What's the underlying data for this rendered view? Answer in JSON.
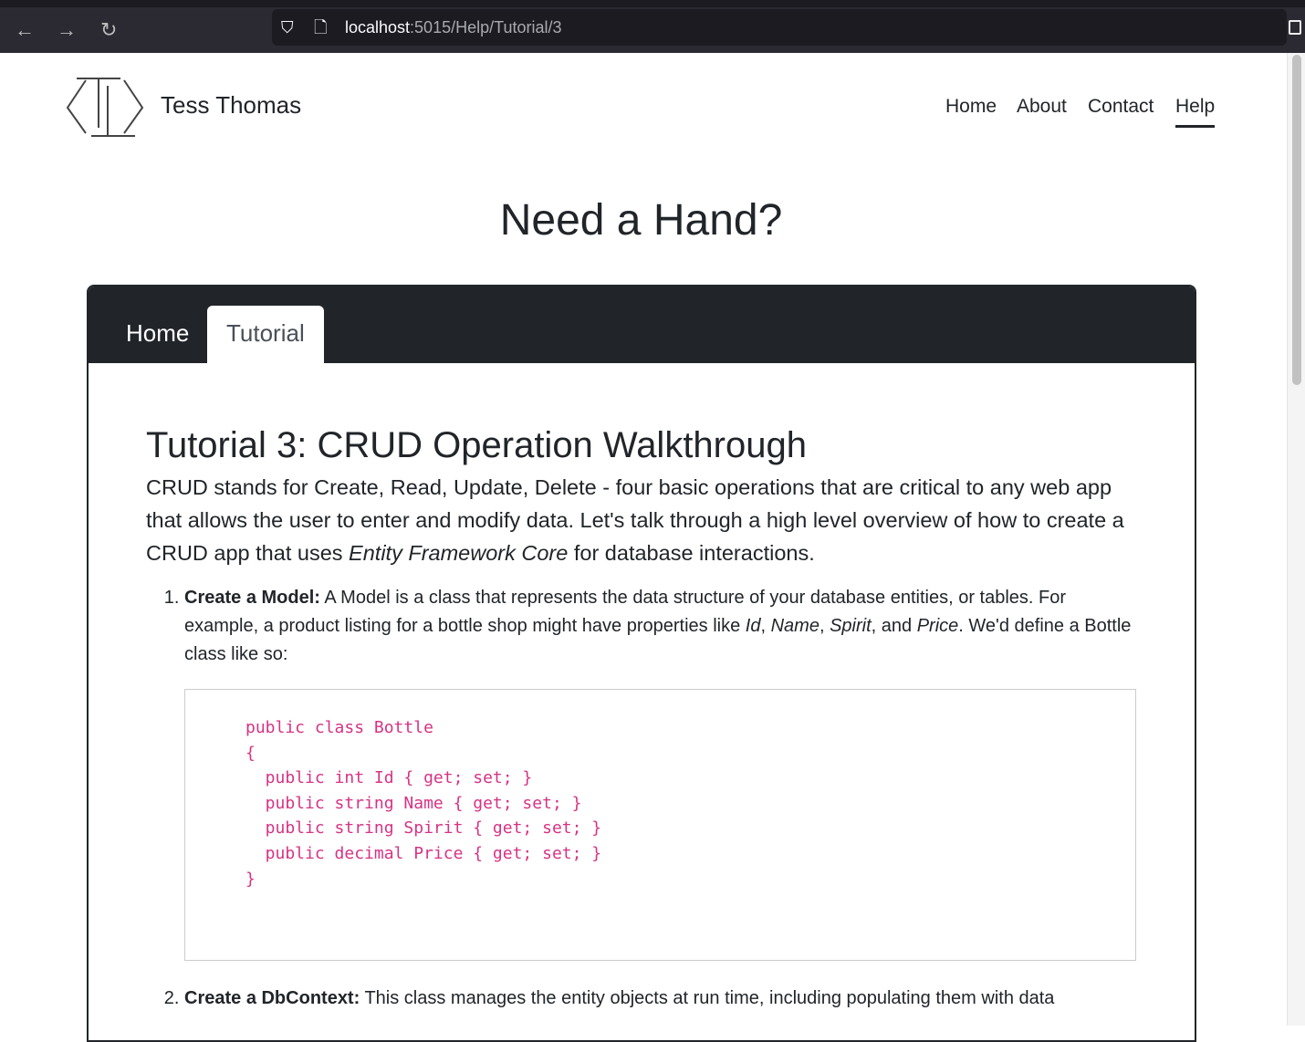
{
  "browser": {
    "url_host": "localhost",
    "url_path": ":5015/Help/Tutorial/3"
  },
  "site": {
    "brand": "Tess Thomas",
    "nav": [
      {
        "label": "Home"
      },
      {
        "label": "About"
      },
      {
        "label": "Contact"
      },
      {
        "label": "Help",
        "active": true
      }
    ]
  },
  "page": {
    "title": "Need a Hand?"
  },
  "tabs": [
    {
      "label": "Home"
    },
    {
      "label": "Tutorial",
      "active": true
    }
  ],
  "tutorial": {
    "title": "Tutorial 3: CRUD Operation Walkthrough",
    "intro_a": "CRUD stands for Create, Read, Update, Delete - four basic operations that are critical to any web app that allows the user to enter and modify data. Let's talk through a high level overview of how to create a CRUD app that uses ",
    "intro_em": "Entity Framework Core",
    "intro_b": " for database interactions.",
    "step1": {
      "bold": "Create a Model:",
      "a": " A Model is a class that represents the data structure of your database entities, or tables. For example, a product listing for a bottle shop might have properties like ",
      "p1": "Id",
      "s1": ", ",
      "p2": "Name",
      "s2": ", ",
      "p3": "Spirit",
      "s3": ", and ",
      "p4": "Price",
      "b": ". We'd define a Bottle class like so:"
    },
    "code": "public class Bottle\n{\n  public int Id { get; set; }\n  public string Name { get; set; }\n  public string Spirit { get; set; }\n  public decimal Price { get; set; }\n}",
    "step2": {
      "bold": "Create a DbContext:",
      "a": " This class manages the entity objects at run time, including populating them with data"
    }
  },
  "colors": {
    "code": "#d63384",
    "dark": "#212529"
  }
}
